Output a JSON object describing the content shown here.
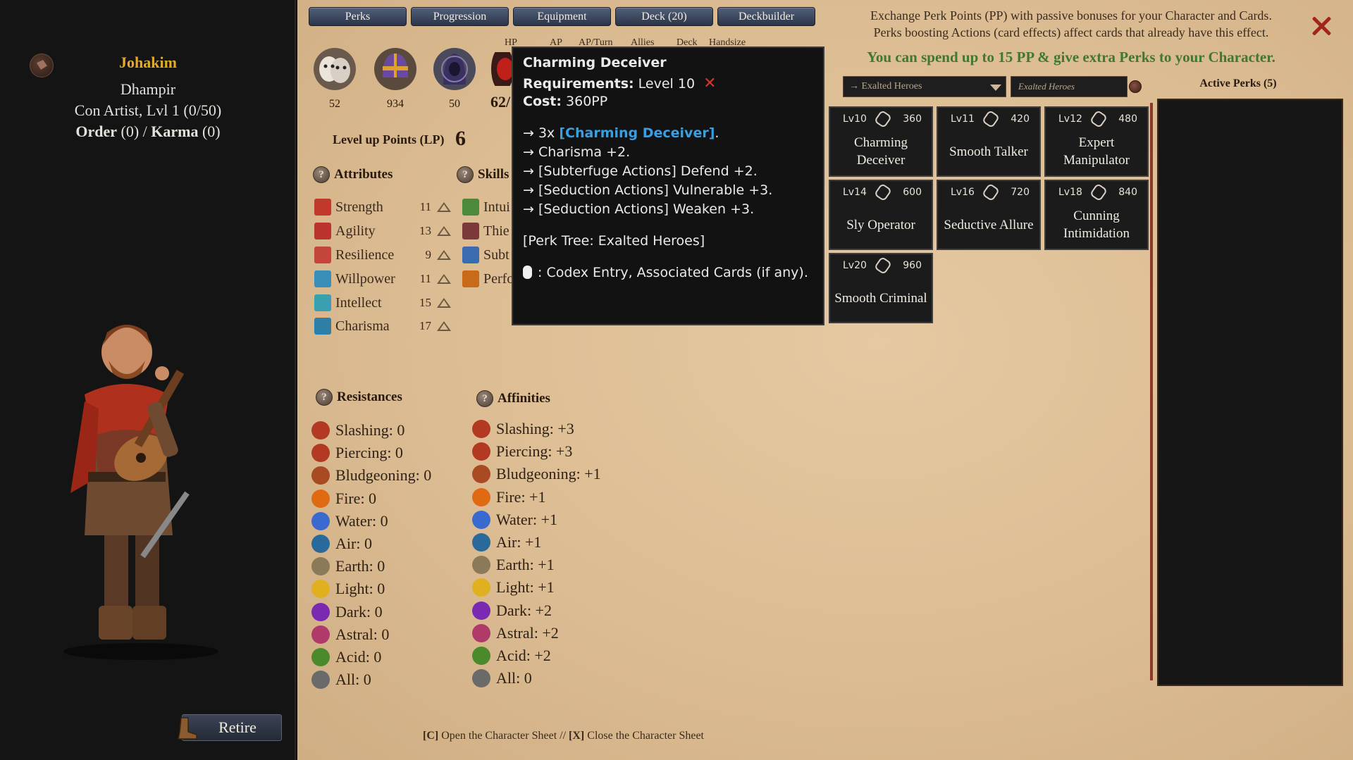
{
  "character": {
    "name": "Johakim",
    "race": "Dhampir",
    "class_line": "Con Artist, Lvl 1 (0/50)",
    "order_label": "Order",
    "order_value": "(0)",
    "separator": "/",
    "karma_label": "Karma",
    "karma_value": "(0)",
    "retire_label": "Retire"
  },
  "tabs": [
    "Perks",
    "Progression",
    "Equipment",
    "Deck (20)",
    "Deckbuilder"
  ],
  "stats": {
    "headers": [
      "HP",
      "AP",
      "AP/Turn",
      "Allies",
      "Deck",
      "Handsize"
    ],
    "values": [
      "52",
      "934",
      "50",
      "62/"
    ]
  },
  "level_up": {
    "label": "Level up Points (LP)",
    "value": "6"
  },
  "attributes": {
    "title": "Attributes",
    "items": [
      {
        "name": "Strength",
        "value": "11",
        "color": "#c0392b"
      },
      {
        "name": "Agility",
        "value": "13",
        "color": "#b8342c"
      },
      {
        "name": "Resilience",
        "value": "9",
        "color": "#c2463a"
      },
      {
        "name": "Willpower",
        "value": "11",
        "color": "#3a8fb8"
      },
      {
        "name": "Intellect",
        "value": "15",
        "color": "#3aa0b0"
      },
      {
        "name": "Charisma",
        "value": "17",
        "color": "#2e7fa8"
      }
    ]
  },
  "skills": {
    "title": "Skills",
    "items": [
      {
        "name": "Intui",
        "color": "#4a8a3a"
      },
      {
        "name": "Thie",
        "color": "#7a3a3a"
      },
      {
        "name": "Subt",
        "color": "#3a6ab0"
      },
      {
        "name": "Perfo",
        "color": "#c86a1a"
      }
    ]
  },
  "resistances": {
    "title": "Resistances",
    "items": [
      "Slashing: 0",
      "Piercing: 0",
      "Bludgeoning: 0",
      "Fire: 0",
      "Water: 0",
      "Air: 0",
      "Earth: 0",
      "Light: 0",
      "Dark: 0",
      "Astral: 0",
      "Acid: 0",
      "All: 0"
    ]
  },
  "affinities": {
    "title": "Affinities",
    "items": [
      "Slashing: +3",
      "Piercing: +3",
      "Bludgeoning: +1",
      "Fire: +1",
      "Water: +1",
      "Air: +1",
      "Earth: +1",
      "Light: +1",
      "Dark: +2",
      "Astral: +2",
      "Acid: +2",
      "All: 0"
    ]
  },
  "element_colors": [
    "#b23a22",
    "#b23a22",
    "#a84a22",
    "#e06a12",
    "#3a6ad0",
    "#2a6a9a",
    "#8a7a5a",
    "#e0b020",
    "#7a2ab0",
    "#b03a6a",
    "#4a8a2a",
    "#6a6a6a"
  ],
  "tooltip": {
    "title": "Charming Deceiver",
    "req_label": "Requirements:",
    "req_value": "Level 10",
    "req_fail": "✕",
    "cost_label": "Cost:",
    "cost_value": "360PP",
    "eff1_prefix": "→ 3x ",
    "eff1_link": "[Charming Deceiver]",
    "eff1_suffix": ".",
    "eff2": "→ Charisma +2.",
    "eff3": "→ [Subterfuge Actions] Defend +2.",
    "eff4": "→ [Seduction Actions] Vulnerable +3.",
    "eff5": "→ [Seduction Actions] Weaken +3.",
    "tree": "[Perk Tree: Exalted Heroes]",
    "hint": ": Codex Entry, Associated Cards (if any)."
  },
  "perks_panel": {
    "exchange_line1": "Exchange Perk Points (PP) with passive bonuses for your Character and Cards.",
    "exchange_line2": "Perks boosting Actions (card effects) affect cards that already have this effect.",
    "highlight": "You can spend up to 15 PP & give extra Perks to your Character.",
    "tree_select": "→ Exalted Heroes",
    "tree_search": "Exalted Heroes",
    "active_title": "Active Perks (5)",
    "cards": [
      {
        "lvl": "Lv10",
        "cost": "360",
        "name": "Charming Deceiver"
      },
      {
        "lvl": "Lv11",
        "cost": "420",
        "name": "Smooth Talker"
      },
      {
        "lvl": "Lv12",
        "cost": "480",
        "name": "Expert Manipulator"
      },
      {
        "lvl": "Lv14",
        "cost": "600",
        "name": "Sly Operator"
      },
      {
        "lvl": "Lv16",
        "cost": "720",
        "name": "Seductive Allure"
      },
      {
        "lvl": "Lv18",
        "cost": "840",
        "name": "Cunning Intimidation"
      },
      {
        "lvl": "Lv20",
        "cost": "960",
        "name": "Smooth Criminal"
      }
    ]
  },
  "footer": {
    "open_key": "[C]",
    "open_text": "Open the Character Sheet",
    "sep": "//",
    "close_key": "[X]",
    "close_text": "Close the Character Sheet"
  }
}
